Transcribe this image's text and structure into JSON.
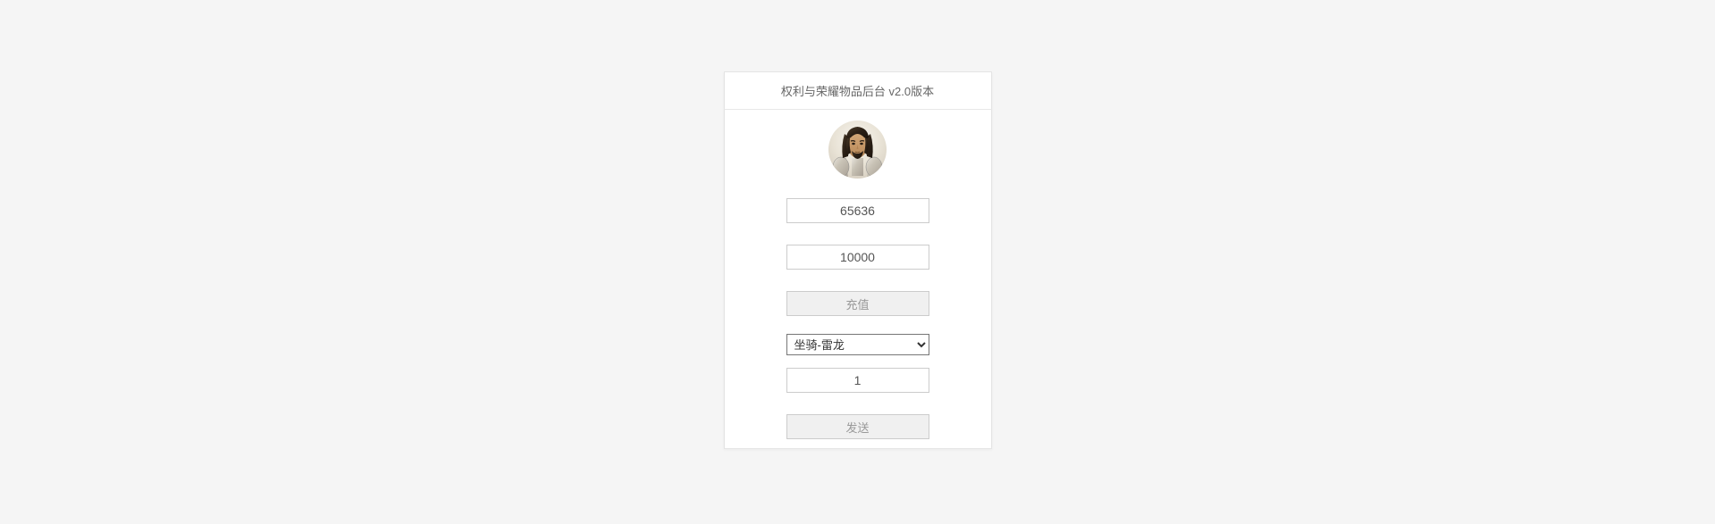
{
  "header": {
    "title": "权利与荣耀物品后台 v2.0版本"
  },
  "form": {
    "id_value": "65636",
    "amount_value": "10000",
    "recharge_label": "充值",
    "item_selected": "坐骑-雷龙",
    "quantity_value": "1",
    "send_label": "发送"
  }
}
